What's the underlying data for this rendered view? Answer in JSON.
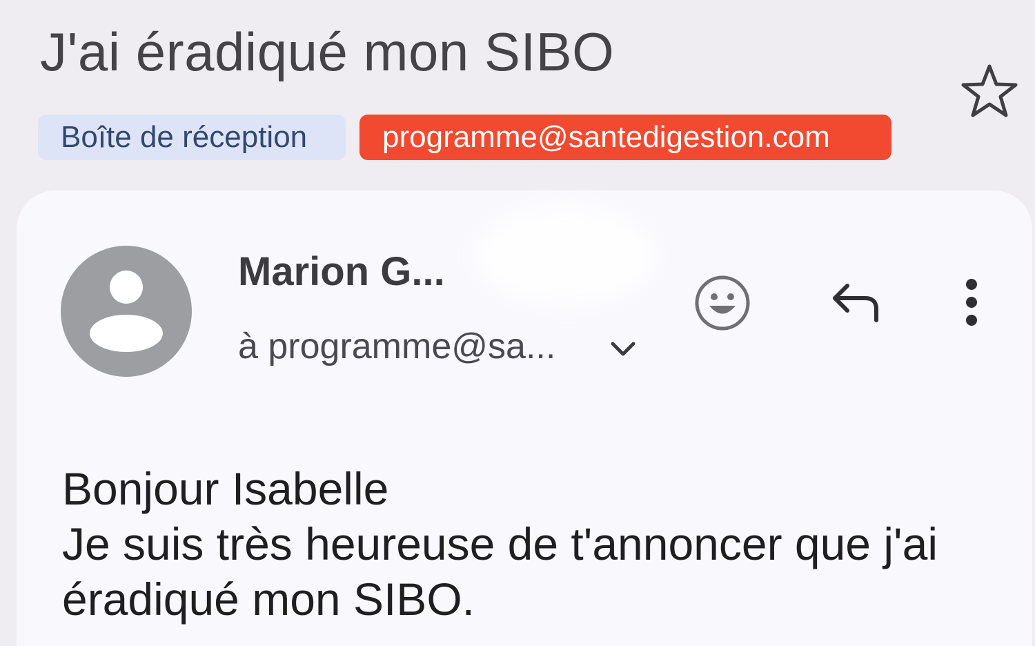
{
  "email": {
    "subject": "J'ai éradiqué mon SIBO",
    "labels": {
      "inbox": "Boîte de réception",
      "sender_label": "programme@santedigestion.com"
    },
    "sender_name": "Marion G...",
    "recipient_line": "à programme@sa...",
    "body_lines": [
      "Bonjour Isabelle",
      "Je suis très heureuse de t'annoncer que j'ai",
      "éradiqué mon SIBO."
    ]
  },
  "icons": {
    "star": "star-outline-icon",
    "avatar": "person-avatar-icon",
    "details": "chevron-down-icon",
    "react": "emoji-smile-icon",
    "reply": "reply-arrow-icon",
    "more": "more-vert-icon"
  },
  "colors": {
    "background": "#efedf2",
    "card": "#f9f8fd",
    "inbox_chip": "#dde4f8",
    "sender_chip": "#f24a30",
    "avatar": "#9c9ea2"
  }
}
